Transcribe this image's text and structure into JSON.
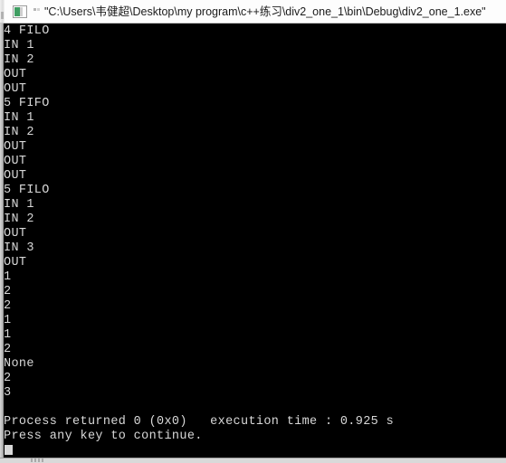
{
  "window": {
    "title": "\"C:\\Users\\韦健超\\Desktop\\my program\\c++练习\\div2_one_1\\bin\\Debug\\div2_one_1.exe\"",
    "icon": "console-app-icon",
    "background_color": "#000000",
    "text_color": "#d8d8d8",
    "titlebar_color": "#fdfdfd"
  },
  "console": {
    "lines": [
      "4 FILO",
      "IN 1",
      "IN 2",
      "OUT",
      "OUT",
      "5 FIFO",
      "IN 1",
      "IN 2",
      "OUT",
      "OUT",
      "OUT",
      "5 FILO",
      "IN 1",
      "IN 2",
      "OUT",
      "IN 3",
      "OUT",
      "1",
      "2",
      "2",
      "1",
      "1",
      "2",
      "None",
      "2",
      "3",
      "",
      "Process returned 0 (0x0)   execution time : 0.925 s",
      "Press any key to continue."
    ],
    "exit_code": "0",
    "exit_code_hex": "0x0",
    "execution_time": "0.925 s",
    "prompt": "Press any key to continue."
  }
}
